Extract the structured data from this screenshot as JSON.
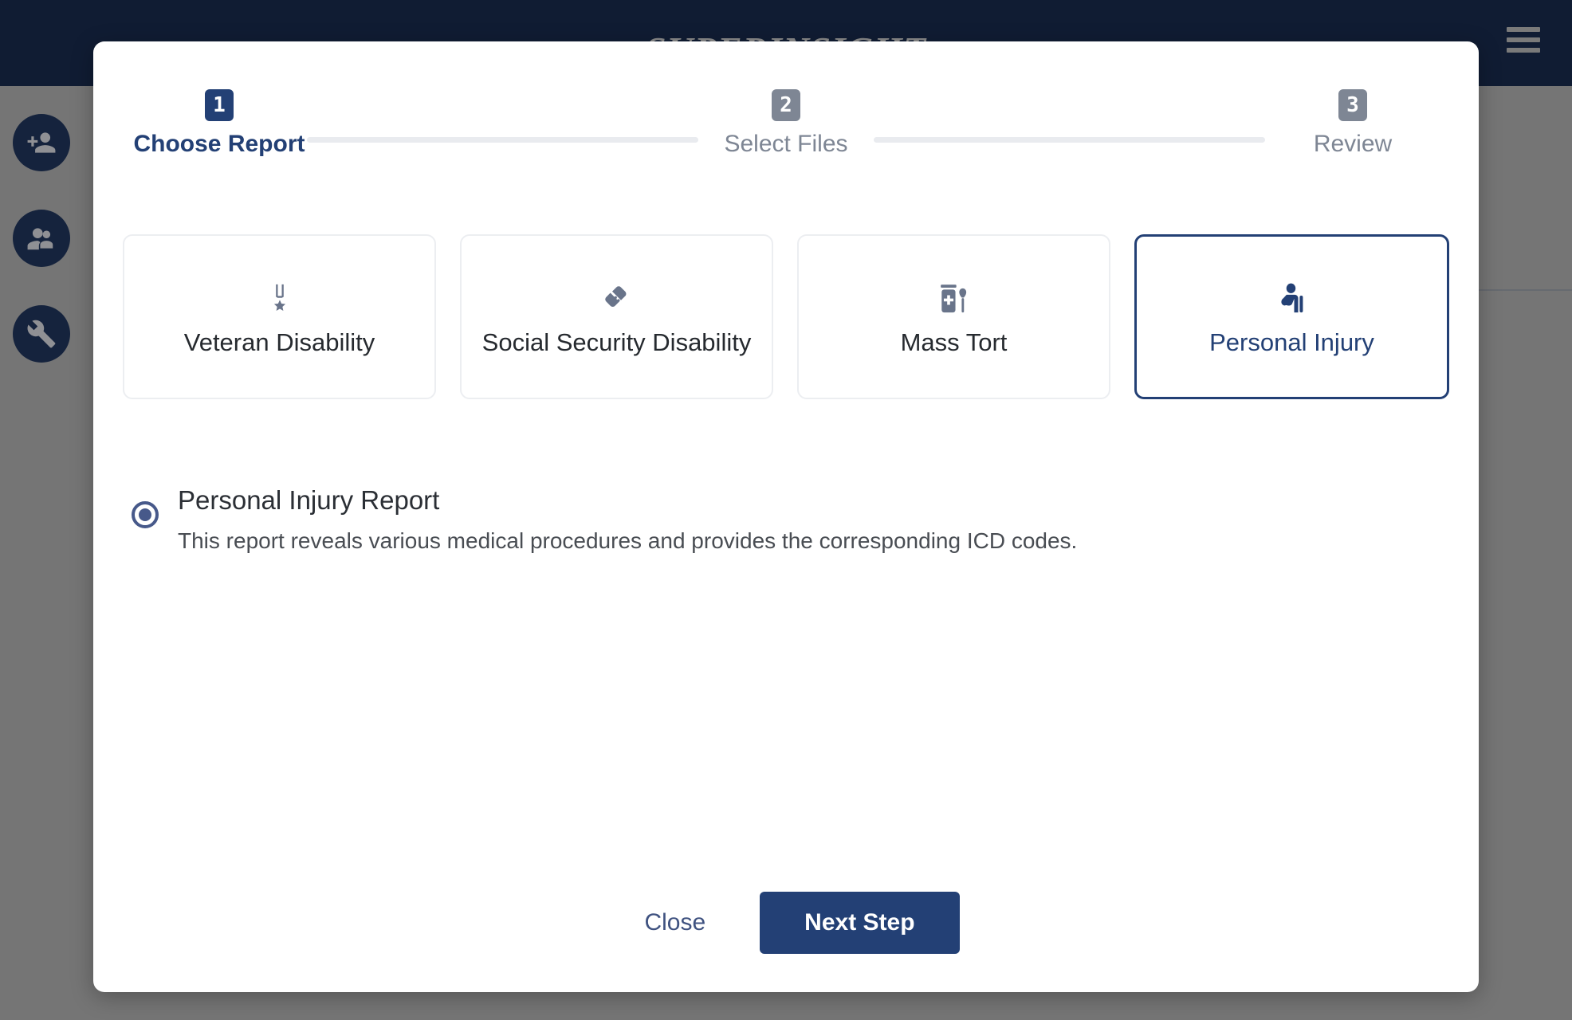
{
  "app": {
    "logo_text": "SUPERINSIGHT",
    "menu_icon": "hamburger-icon",
    "rail": [
      {
        "icon": "person-add-icon",
        "name": "add-person"
      },
      {
        "icon": "people-icon",
        "name": "people"
      },
      {
        "icon": "wrench-icon",
        "name": "tools"
      }
    ]
  },
  "modal": {
    "stepper": {
      "steps": [
        {
          "number": "1",
          "label": "Choose Report",
          "state": "active"
        },
        {
          "number": "2",
          "label": "Select Files",
          "state": "inactive"
        },
        {
          "number": "3",
          "label": "Review",
          "state": "inactive"
        }
      ]
    },
    "report_types": [
      {
        "label": "Veteran Disability",
        "icon": "medal-icon",
        "selected": false
      },
      {
        "label": "Social Security Disability",
        "icon": "bandage-icon",
        "selected": false
      },
      {
        "label": "Mass Tort",
        "icon": "pill-bottle-icon",
        "selected": false
      },
      {
        "label": "Personal Injury",
        "icon": "injured-person-icon",
        "selected": true
      }
    ],
    "options": [
      {
        "title": "Personal Injury Report",
        "description": "This report reveals various medical procedures and provides the corresponding ICD codes.",
        "selected": true
      }
    ],
    "footer": {
      "close_label": "Close",
      "next_label": "Next Step"
    }
  },
  "colors": {
    "brand_navy": "#234075",
    "topbar": "#101c33",
    "scrim": "#757575",
    "muted": "#7e8694",
    "icon_gray": "#69748a"
  }
}
